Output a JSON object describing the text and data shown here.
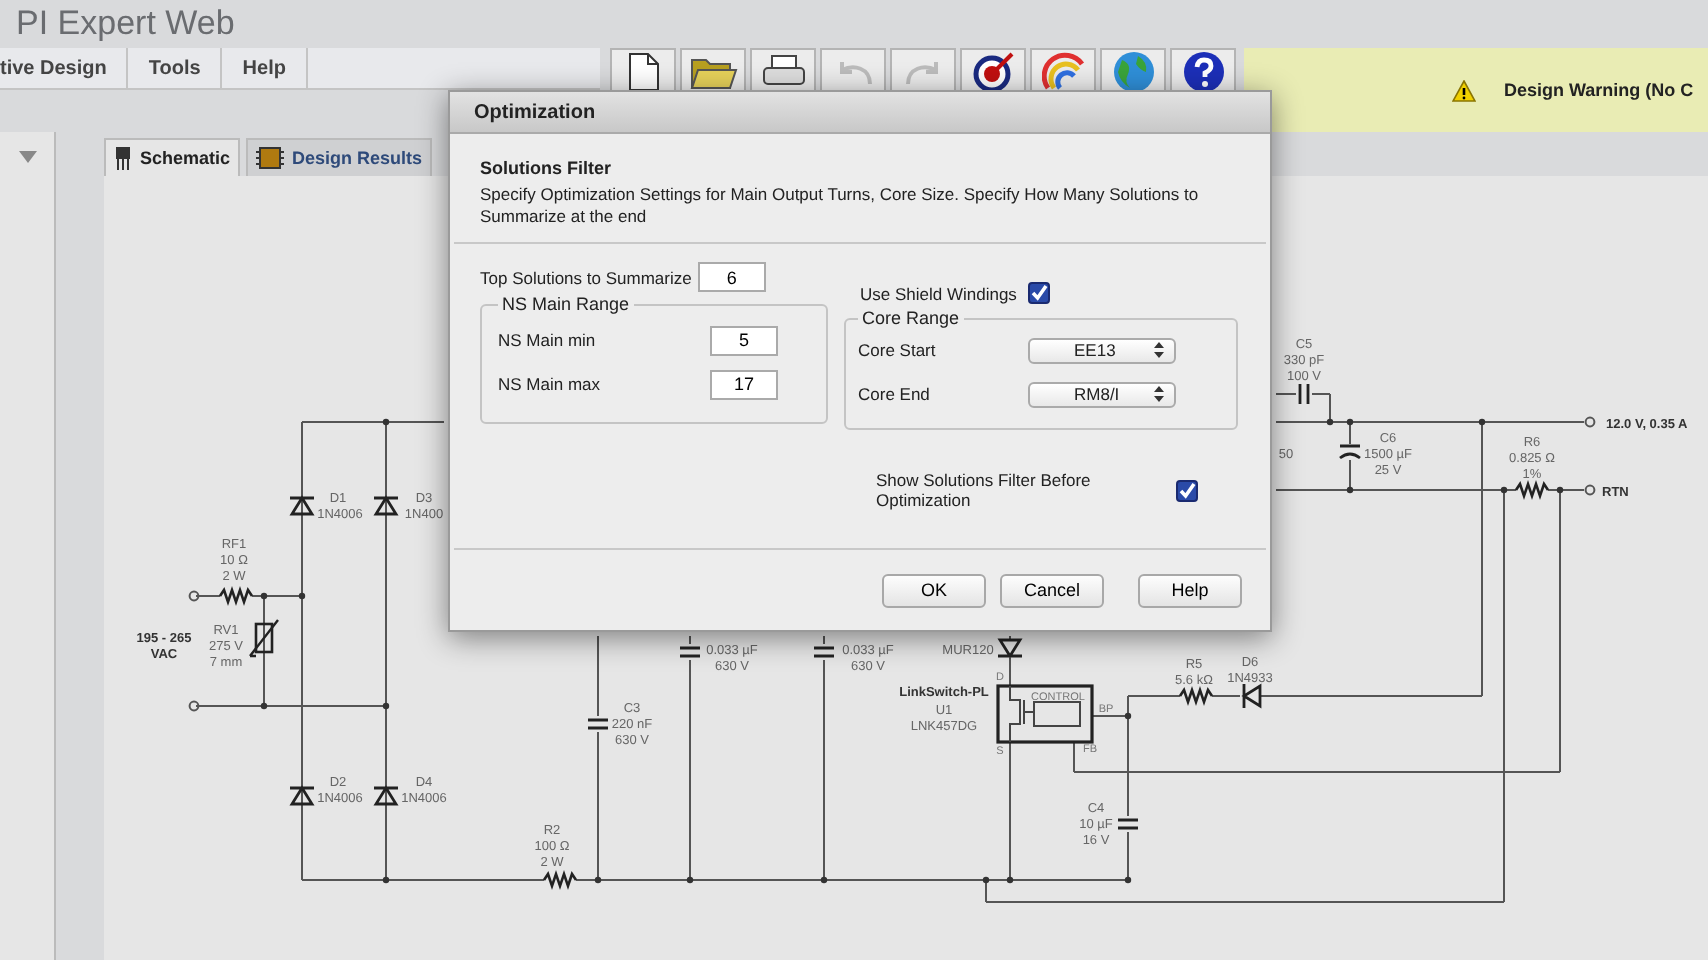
{
  "app": {
    "title": "PI Expert Web"
  },
  "menu": [
    {
      "label": "tive Design"
    },
    {
      "label": "Tools"
    },
    {
      "label": "Help"
    }
  ],
  "toolbar": [
    {
      "kind": "new",
      "disabled": false
    },
    {
      "kind": "open",
      "disabled": false
    },
    {
      "kind": "print",
      "disabled": false
    },
    {
      "kind": "undo",
      "disabled": true
    },
    {
      "kind": "redo",
      "disabled": true
    },
    {
      "kind": "target",
      "disabled": false
    },
    {
      "kind": "wand",
      "disabled": false
    },
    {
      "kind": "globe",
      "disabled": false
    },
    {
      "kind": "help",
      "disabled": false
    }
  ],
  "warning": {
    "text": "Design Warning (No C"
  },
  "tabs": [
    {
      "label": "Schematic",
      "selected": true
    },
    {
      "label": "Design Results",
      "selected": false
    }
  ],
  "schematic": {
    "labels": [
      {
        "text": "D1",
        "kind": "part"
      },
      {
        "text": "1N4006",
        "kind": "part"
      },
      {
        "text": "D3",
        "kind": "part"
      },
      {
        "text": "1N400",
        "kind": "part"
      },
      {
        "text": "RF1",
        "kind": "part"
      },
      {
        "text": "10 Ω",
        "kind": "part"
      },
      {
        "text": "2 W",
        "kind": "part"
      },
      {
        "text": "RV1",
        "kind": "part"
      },
      {
        "text": "275 V",
        "kind": "part"
      },
      {
        "text": "7 mm",
        "kind": "part"
      },
      {
        "text": "195 - 265",
        "kind": "bold"
      },
      {
        "text": "VAC",
        "kind": "bold"
      },
      {
        "text": "C3",
        "kind": "part"
      },
      {
        "text": "220 nF",
        "kind": "part"
      },
      {
        "text": "630 V",
        "kind": "part"
      },
      {
        "text": "D2",
        "kind": "part"
      },
      {
        "text": "1N4006",
        "kind": "part"
      },
      {
        "text": "D4",
        "kind": "part"
      },
      {
        "text": "1N4006",
        "kind": "part"
      },
      {
        "text": "R2",
        "kind": "part"
      },
      {
        "text": "100 Ω",
        "kind": "part"
      },
      {
        "text": "2 W",
        "kind": "part"
      },
      {
        "text": "0.033 µF",
        "kind": "part"
      },
      {
        "text": "630 V",
        "kind": "part"
      },
      {
        "text": "0.033 µF",
        "kind": "part"
      },
      {
        "text": "630 V",
        "kind": "part"
      },
      {
        "text": "MUR120",
        "kind": "part"
      },
      {
        "text": "LinkSwitch-PL",
        "kind": "bold"
      },
      {
        "text": "U1",
        "kind": "part"
      },
      {
        "text": "LNK457DG",
        "kind": "part"
      },
      {
        "text": "CONTROL",
        "kind": "pin"
      },
      {
        "text": "D",
        "kind": "pin"
      },
      {
        "text": "S",
        "kind": "pin"
      },
      {
        "text": "BP",
        "kind": "pin"
      },
      {
        "text": "FB",
        "kind": "pin"
      },
      {
        "text": "R5",
        "kind": "part"
      },
      {
        "text": "5.6 kΩ",
        "kind": "part"
      },
      {
        "text": "D6",
        "kind": "part"
      },
      {
        "text": "1N4933",
        "kind": "part"
      },
      {
        "text": "C4",
        "kind": "part"
      },
      {
        "text": "10 µF",
        "kind": "part"
      },
      {
        "text": "16 V",
        "kind": "part"
      },
      {
        "text": "C5",
        "kind": "part"
      },
      {
        "text": "330 pF",
        "kind": "part"
      },
      {
        "text": "100 V",
        "kind": "part"
      },
      {
        "text": "50",
        "kind": "part"
      },
      {
        "text": "C6",
        "kind": "part"
      },
      {
        "text": "1500 µF",
        "kind": "part"
      },
      {
        "text": "25 V",
        "kind": "part"
      },
      {
        "text": "R6",
        "kind": "part"
      },
      {
        "text": "0.825 Ω",
        "kind": "part"
      },
      {
        "text": "1%",
        "kind": "part"
      },
      {
        "text": "12.0 V, 0.35 A",
        "kind": "bold"
      },
      {
        "text": "RTN",
        "kind": "bold"
      }
    ]
  },
  "dialog": {
    "title": "Optimization",
    "section": "Solutions Filter",
    "description": "Specify Optimization Settings for Main Output Turns, Core Size. Specify How Many Solutions to Summarize at the end",
    "top_solutions": {
      "label": "Top Solutions to Summarize",
      "value": "6"
    },
    "ns_range": {
      "legend": "NS Main Range",
      "min": {
        "label": "NS Main min",
        "value": "5"
      },
      "max": {
        "label": "NS Main max",
        "value": "17"
      }
    },
    "shield": {
      "label": "Use Shield Windings",
      "checked": true
    },
    "core_range": {
      "legend": "Core Range",
      "start": {
        "label": "Core Start",
        "value": "EE13"
      },
      "end": {
        "label": "Core End",
        "value": "RM8/I"
      }
    },
    "show_filter": {
      "label": "Show Solutions Filter Before Optimization",
      "checked": true
    },
    "buttons": [
      "OK",
      "Cancel",
      "Help"
    ]
  }
}
